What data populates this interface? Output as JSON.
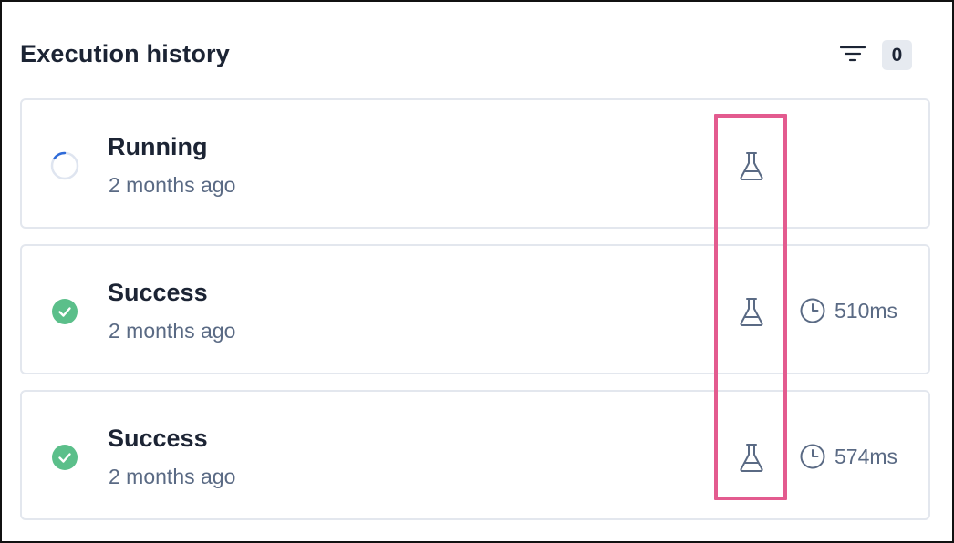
{
  "panel": {
    "title": "Execution history",
    "filter_icon": "filter-icon",
    "filter_count": "0"
  },
  "executions": [
    {
      "status": "Running",
      "status_icon": "spinner-icon",
      "time_ago": "2 months ago",
      "action_icon": "flask-icon",
      "duration": ""
    },
    {
      "status": "Success",
      "status_icon": "check-circle-icon",
      "time_ago": "2 months ago",
      "action_icon": "flask-icon",
      "duration": "510ms"
    },
    {
      "status": "Success",
      "status_icon": "check-circle-icon",
      "time_ago": "2 months ago",
      "action_icon": "flask-icon",
      "duration": "574ms"
    }
  ],
  "colors": {
    "success": "#5bbf8a",
    "spinner": "#2f6bd8",
    "highlight": "#e35b8f",
    "muted_text": "#5a6a84"
  }
}
